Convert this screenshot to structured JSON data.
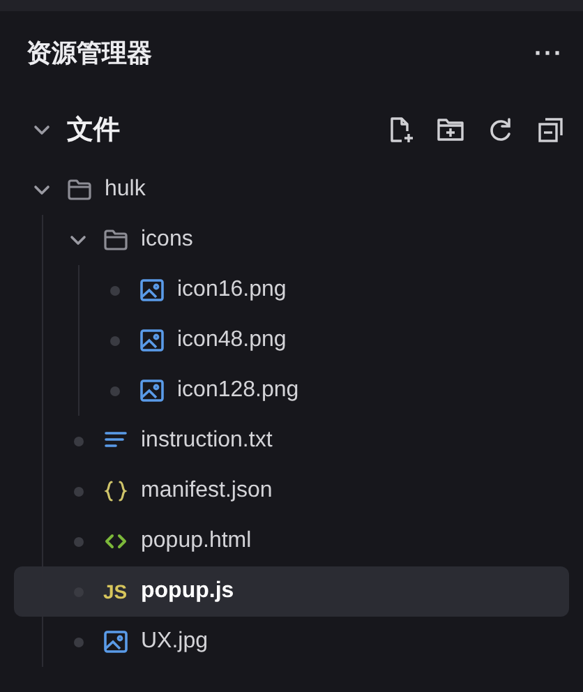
{
  "panel": {
    "title": "资源管理器",
    "more": "···"
  },
  "section": {
    "title": "文件",
    "expanded": true
  },
  "tree": [
    {
      "name": "hulk",
      "kind": "folder",
      "expanded": true,
      "selected": false,
      "children": [
        {
          "name": "icons",
          "kind": "folder",
          "expanded": true,
          "selected": false,
          "children": [
            {
              "name": "icon16.png",
              "kind": "image",
              "selected": false
            },
            {
              "name": "icon48.png",
              "kind": "image",
              "selected": false
            },
            {
              "name": "icon128.png",
              "kind": "image",
              "selected": false
            }
          ]
        },
        {
          "name": "instruction.txt",
          "kind": "text",
          "selected": false
        },
        {
          "name": "manifest.json",
          "kind": "json",
          "selected": false
        },
        {
          "name": "popup.html",
          "kind": "html",
          "selected": false
        },
        {
          "name": "popup.js",
          "kind": "js",
          "badge": "JS",
          "selected": true
        },
        {
          "name": "UX.jpg",
          "kind": "image",
          "selected": false
        }
      ]
    }
  ]
}
